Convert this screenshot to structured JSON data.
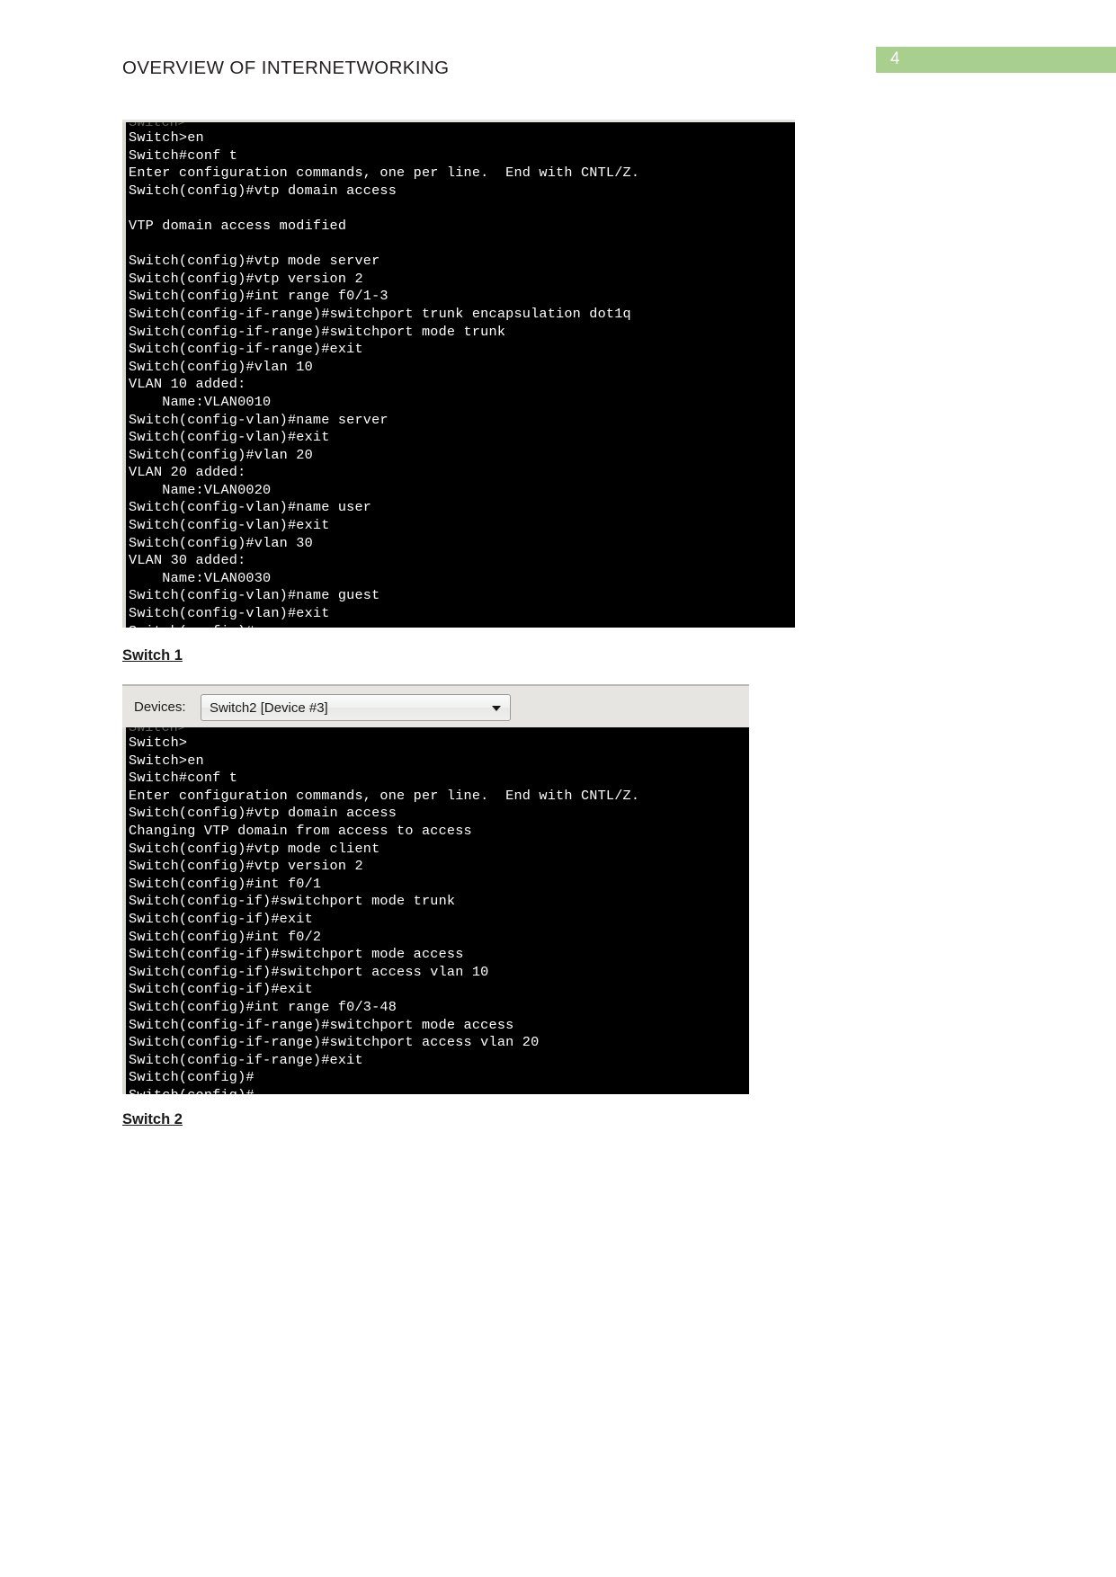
{
  "header": {
    "title": "OVERVIEW OF INTERNETWORKING",
    "page_number": "4",
    "badge_color": "#a8cf8e"
  },
  "terminal_1": {
    "clipped_top_line": "Switch>",
    "lines": [
      "Switch>en",
      "Switch#conf t",
      "Enter configuration commands, one per line.  End with CNTL/Z.",
      "Switch(config)#vtp domain access",
      "",
      "VTP domain access modified",
      "",
      "Switch(config)#vtp mode server",
      "Switch(config)#vtp version 2",
      "Switch(config)#int range f0/1-3",
      "Switch(config-if-range)#switchport trunk encapsulation dot1q",
      "Switch(config-if-range)#switchport mode trunk",
      "Switch(config-if-range)#exit",
      "Switch(config)#vlan 10",
      "VLAN 10 added:",
      "    Name:VLAN0010",
      "Switch(config-vlan)#name server",
      "Switch(config-vlan)#exit",
      "Switch(config)#vlan 20",
      "VLAN 20 added:",
      "    Name:VLAN0020",
      "Switch(config-vlan)#name user",
      "Switch(config-vlan)#exit",
      "Switch(config)#vlan 30",
      "VLAN 30 added:",
      "    Name:VLAN0030",
      "Switch(config-vlan)#name guest",
      "Switch(config-vlan)#exit",
      "Switch(config)#"
    ]
  },
  "caption_1": "Switch 1",
  "devices_toolbar": {
    "label": "Devices:",
    "selected_value": "Switch2 [Device #3]",
    "arrow_icon": "chevron-down-icon"
  },
  "terminal_2": {
    "clipped_top_line": "Switch>",
    "lines": [
      "Switch>",
      "Switch>en",
      "Switch#conf t",
      "Enter configuration commands, one per line.  End with CNTL/Z.",
      "Switch(config)#vtp domain access",
      "Changing VTP domain from access to access",
      "Switch(config)#vtp mode client",
      "Switch(config)#vtp version 2",
      "Switch(config)#int f0/1",
      "Switch(config-if)#switchport mode trunk",
      "Switch(config-if)#exit",
      "Switch(config)#int f0/2",
      "Switch(config-if)#switchport mode access",
      "Switch(config-if)#switchport access vlan 10",
      "Switch(config-if)#exit",
      "Switch(config)#int range f0/3-48",
      "Switch(config-if-range)#switchport mode access",
      "Switch(config-if-range)#switchport access vlan 20",
      "Switch(config-if-range)#exit",
      "Switch(config)#",
      "Switch(config)#"
    ]
  },
  "caption_2": "Switch 2"
}
